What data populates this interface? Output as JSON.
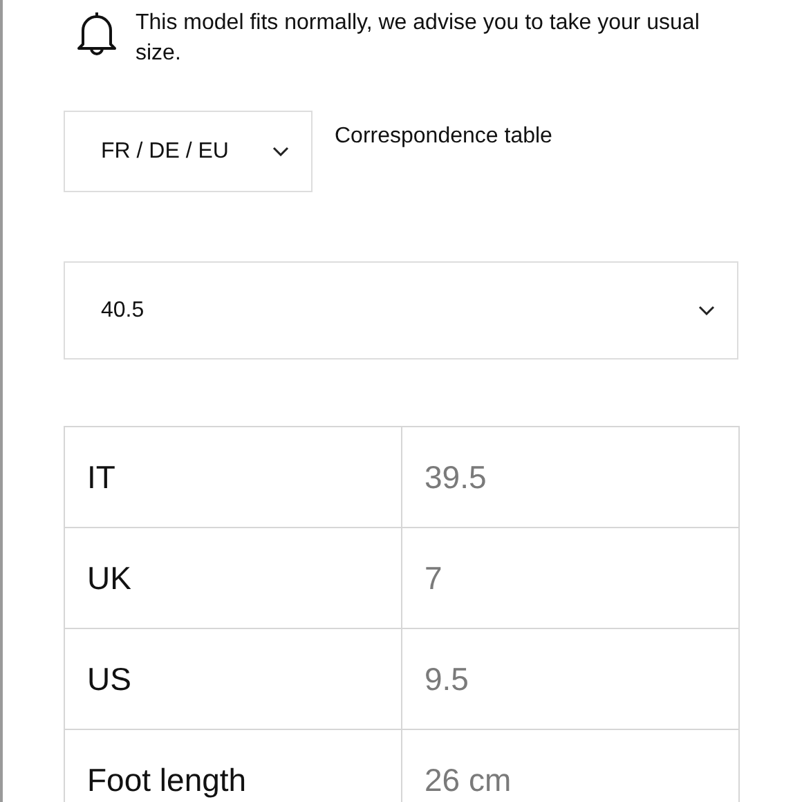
{
  "fit_notice": "This model fits normally, we advise you to take your usual size.",
  "size_system": {
    "value": "FR / DE / EU"
  },
  "correspondence_link": "Correspondence table",
  "size_select": {
    "value": "40.5"
  },
  "table": {
    "rows": [
      {
        "label": "IT",
        "value": "39.5"
      },
      {
        "label": "UK",
        "value": "7"
      },
      {
        "label": "US",
        "value": "9.5"
      },
      {
        "label": "Foot length",
        "value": "26 cm"
      }
    ]
  }
}
